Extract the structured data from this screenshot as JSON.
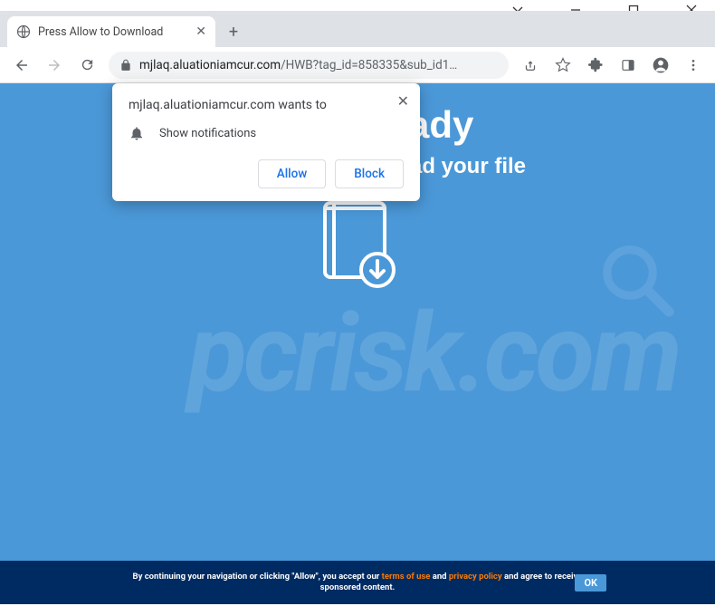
{
  "window": {
    "tab_title": "Press Allow to Download"
  },
  "omnibox": {
    "host": "mjlaq.aluationiamcur.com",
    "path": "/HWB?tag_id=858335&sub_id1…"
  },
  "page": {
    "headline": "File is Ready",
    "subline": "Click allow to download your file"
  },
  "prompt": {
    "origin": "mjlaq.aluationiamcur.com wants to",
    "permission": "Show notifications",
    "allow": "Allow",
    "block": "Block"
  },
  "footer": {
    "prefix": "By continuing your navigation or clicking \"Allow\", you accept our ",
    "terms": "terms of use",
    "and": " and ",
    "privacy": "privacy policy",
    "suffix": " and agree to receive sponsored content.",
    "ok": "OK"
  },
  "watermark": "pcrisk.com"
}
